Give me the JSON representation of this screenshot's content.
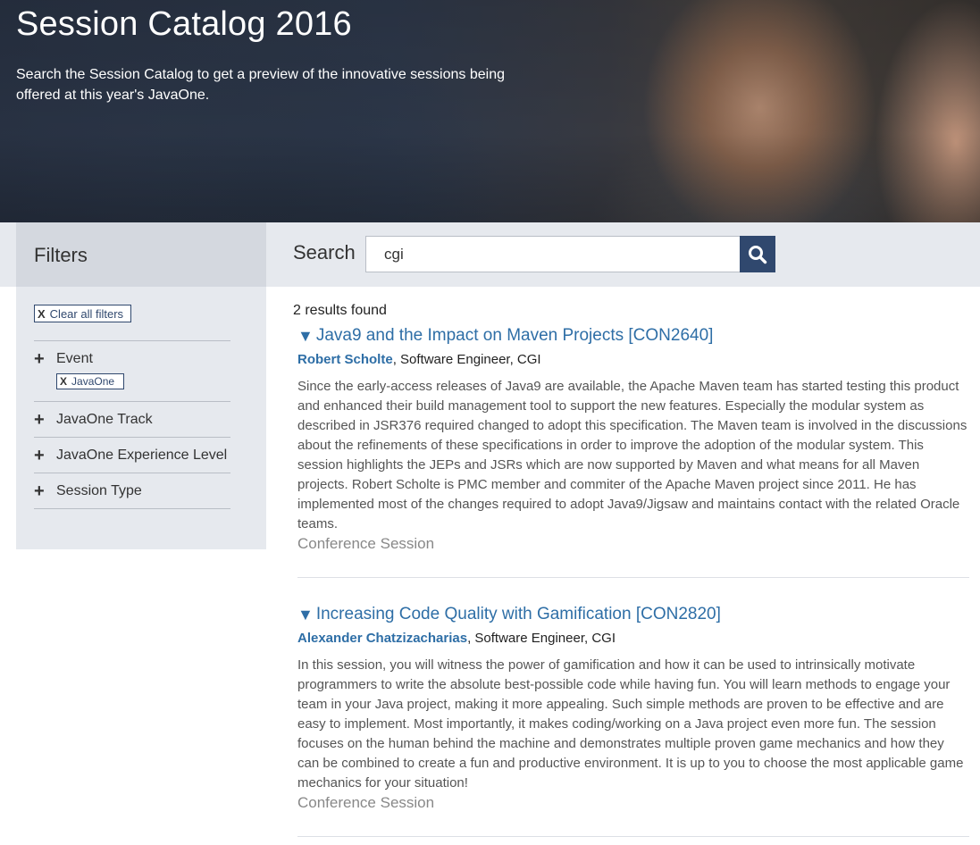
{
  "hero": {
    "title": "Session Catalog 2016",
    "description": "Search the Session Catalog to get a preview of the innovative sessions being offered at this year's JavaOne."
  },
  "filters": {
    "heading": "Filters",
    "clear_all_label": "Clear all filters",
    "clear_icon": "x-icon",
    "groups": [
      {
        "label": "Event",
        "active_tag": "JavaOne"
      },
      {
        "label": "JavaOne Track"
      },
      {
        "label": "JavaOne Experience Level"
      },
      {
        "label": "Session Type"
      }
    ]
  },
  "search": {
    "label": "Search",
    "value": "cgi",
    "button_icon": "search-icon"
  },
  "results": {
    "count_text": "2 results found",
    "items": [
      {
        "title": "Java9 and the Impact on Maven Projects [CON2640]",
        "author": "Robert Scholte",
        "role": ", Software Engineer, CGI",
        "abstract": "Since the early-access releases of Java9 are available, the Apache Maven team has started testing this product and enhanced their build management tool to support the new features. Especially the modular system as described in JSR376 required changed to adopt this specification. The Maven team is involved in the discussions about the refinements of these specifications in order to improve the adoption of the modular system. This session highlights the JEPs and JSRs which are now supported by Maven and what means for all Maven projects. Robert Scholte is PMC member and commiter of the Apache Maven project since 2011. He has implemented most of the changes required to adopt Java9/Jigsaw and maintains contact with the related Oracle teams.",
        "type": "Conference Session"
      },
      {
        "title": "Increasing Code Quality with Gamification [CON2820]",
        "author": "Alexander Chatzizacharias",
        "role": ", Software Engineer, CGI",
        "abstract": "In this session, you will witness the power of gamification and how it can be used to intrinsically motivate programmers to write the absolute best-possible code while having fun. You will learn methods to engage your team in your Java project, making it more appealing. Such simple methods are proven to be effective and are easy to implement. Most importantly, it makes coding/working on a Java project even more fun. The session focuses on the human behind the machine and demonstrates multiple proven game mechanics and how they can be combined to create a fun and productive environment. It is up to you to choose the most applicable game mechanics for your situation!",
        "type": "Conference Session"
      }
    ]
  },
  "colors": {
    "accent_blue": "#2e6ea6",
    "search_button": "#30486e",
    "sidebar_bg": "#e6e9ee",
    "filters_head_bg": "#d4d8df"
  }
}
